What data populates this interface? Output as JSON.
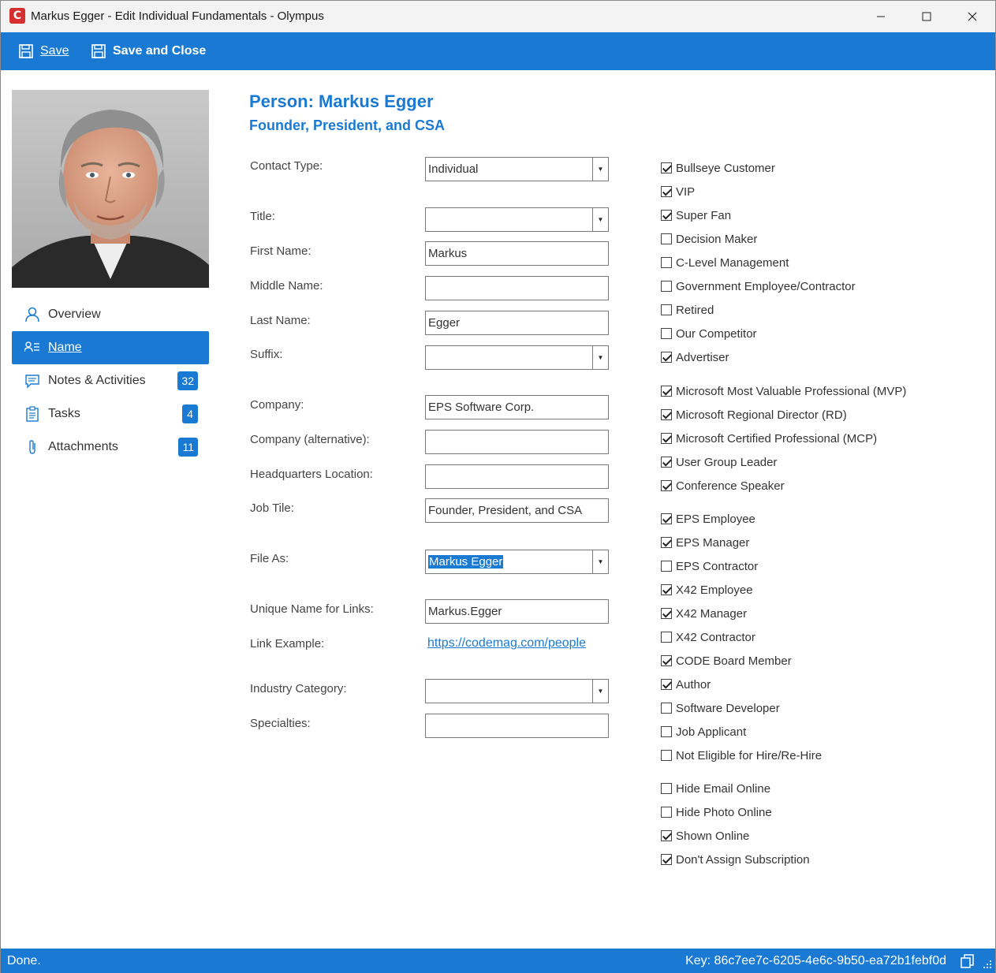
{
  "window": {
    "title": "Markus Egger - Edit Individual Fundamentals - Olympus",
    "logo_letter": "C",
    "minimize": "—",
    "maximize": "☐",
    "close": "✕"
  },
  "toolbar": {
    "save_label": "Save",
    "save_close_label": "Save and Close"
  },
  "sidebar": {
    "items": [
      {
        "label": "Overview",
        "icon": "person-icon"
      },
      {
        "label": "Name",
        "icon": "name-list-icon",
        "active": true
      },
      {
        "label": "Notes & Activities",
        "icon": "notes-icon",
        "badge": "32"
      },
      {
        "label": "Tasks",
        "icon": "clipboard-icon",
        "badge": "4"
      },
      {
        "label": "Attachments",
        "icon": "paperclip-icon",
        "badge": "11"
      }
    ]
  },
  "header": {
    "title": "Person: Markus Egger",
    "subtitle": "Founder, President, and CSA"
  },
  "form": {
    "contact_type": {
      "label": "Contact Type:",
      "value": "Individual"
    },
    "title": {
      "label": "Title:",
      "value": ""
    },
    "first_name": {
      "label": "First Name:",
      "value": "Markus"
    },
    "middle_name": {
      "label": "Middle Name:",
      "value": ""
    },
    "last_name": {
      "label": "Last Name:",
      "value": "Egger"
    },
    "suffix": {
      "label": "Suffix:",
      "value": ""
    },
    "company": {
      "label": "Company:",
      "value": "EPS Software Corp."
    },
    "company_alt": {
      "label": "Company (alternative):",
      "value": ""
    },
    "hq_location": {
      "label": "Headquarters Location:",
      "value": ""
    },
    "job_title": {
      "label": "Job Tile:",
      "value": "Founder, President, and CSA"
    },
    "file_as": {
      "label": "File As:",
      "value": "Markus Egger"
    },
    "unique_name": {
      "label": "Unique Name for Links:",
      "value": "Markus.Egger"
    },
    "link_example": {
      "label": "Link Example:",
      "value": "https://codemag.com/people"
    },
    "industry_category": {
      "label": "Industry Category:",
      "value": ""
    },
    "specialties": {
      "label": "Specialties:",
      "value": ""
    }
  },
  "checkboxes": [
    {
      "label": "Bullseye Customer",
      "checked": true
    },
    {
      "label": "VIP",
      "checked": true
    },
    {
      "label": "Super Fan",
      "checked": true
    },
    {
      "label": "Decision Maker",
      "checked": false
    },
    {
      "label": "C-Level Management",
      "checked": false
    },
    {
      "label": "Government Employee/Contractor",
      "checked": false
    },
    {
      "label": "Retired",
      "checked": false
    },
    {
      "label": "Our Competitor",
      "checked": false
    },
    {
      "label": "Advertiser",
      "checked": true
    },
    {
      "label": "Microsoft Most Valuable Professional (MVP)",
      "checked": true
    },
    {
      "label": "Microsoft Regional Director (RD)",
      "checked": true
    },
    {
      "label": "Microsoft Certified Professional (MCP)",
      "checked": true
    },
    {
      "label": "User Group Leader",
      "checked": true
    },
    {
      "label": "Conference Speaker",
      "checked": true
    },
    {
      "label": "EPS Employee",
      "checked": true
    },
    {
      "label": "EPS Manager",
      "checked": true
    },
    {
      "label": "EPS Contractor",
      "checked": false
    },
    {
      "label": "X42 Employee",
      "checked": true
    },
    {
      "label": "X42 Manager",
      "checked": true
    },
    {
      "label": "X42 Contractor",
      "checked": false
    },
    {
      "label": "CODE Board Member",
      "checked": true
    },
    {
      "label": "Author",
      "checked": true
    },
    {
      "label": "Software Developer",
      "checked": false
    },
    {
      "label": "Job Applicant",
      "checked": false
    },
    {
      "label": "Not Eligible for Hire/Re-Hire",
      "checked": false
    },
    {
      "label": "Hide Email Online",
      "checked": false
    },
    {
      "label": "Hide Photo Online",
      "checked": false
    },
    {
      "label": "Shown Online",
      "checked": true
    },
    {
      "label": "Don't Assign Subscription",
      "checked": true
    }
  ],
  "status": {
    "text": "Done.",
    "key": "Key: 86c7ee7c-6205-4e6c-9b50-ea72b1febf0d"
  },
  "colors": {
    "accent": "#1a7ad3",
    "logo": "#d62f2f"
  }
}
